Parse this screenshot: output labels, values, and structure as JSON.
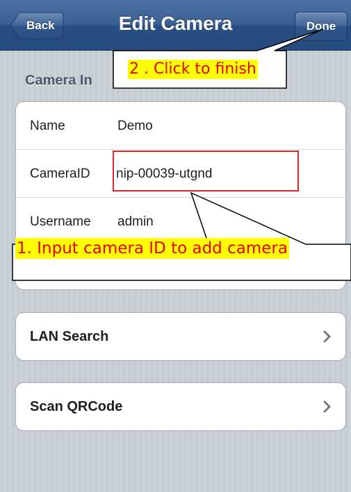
{
  "navbar": {
    "title": "Edit Camera",
    "back_label": "Back",
    "done_label": "Done"
  },
  "section": {
    "header": "Camera In"
  },
  "camera_fields": [
    {
      "label": "Name",
      "value": "Demo"
    },
    {
      "label": "CameraID",
      "value": "nip-00039-utgnd"
    },
    {
      "label": "Username",
      "value": "admin"
    }
  ],
  "actions": {
    "lan_search": "LAN Search",
    "scan_qrcode": "Scan QRCode"
  },
  "annotations": {
    "step2": "2 . Click to finish",
    "step1": "1. Input camera ID to add camera"
  },
  "colors": {
    "nav_bar": "#2f5588",
    "background": "#c5ccd4",
    "highlight": "#ffff00",
    "annotation_text": "#e60012",
    "box_outline": "#e0262b"
  }
}
